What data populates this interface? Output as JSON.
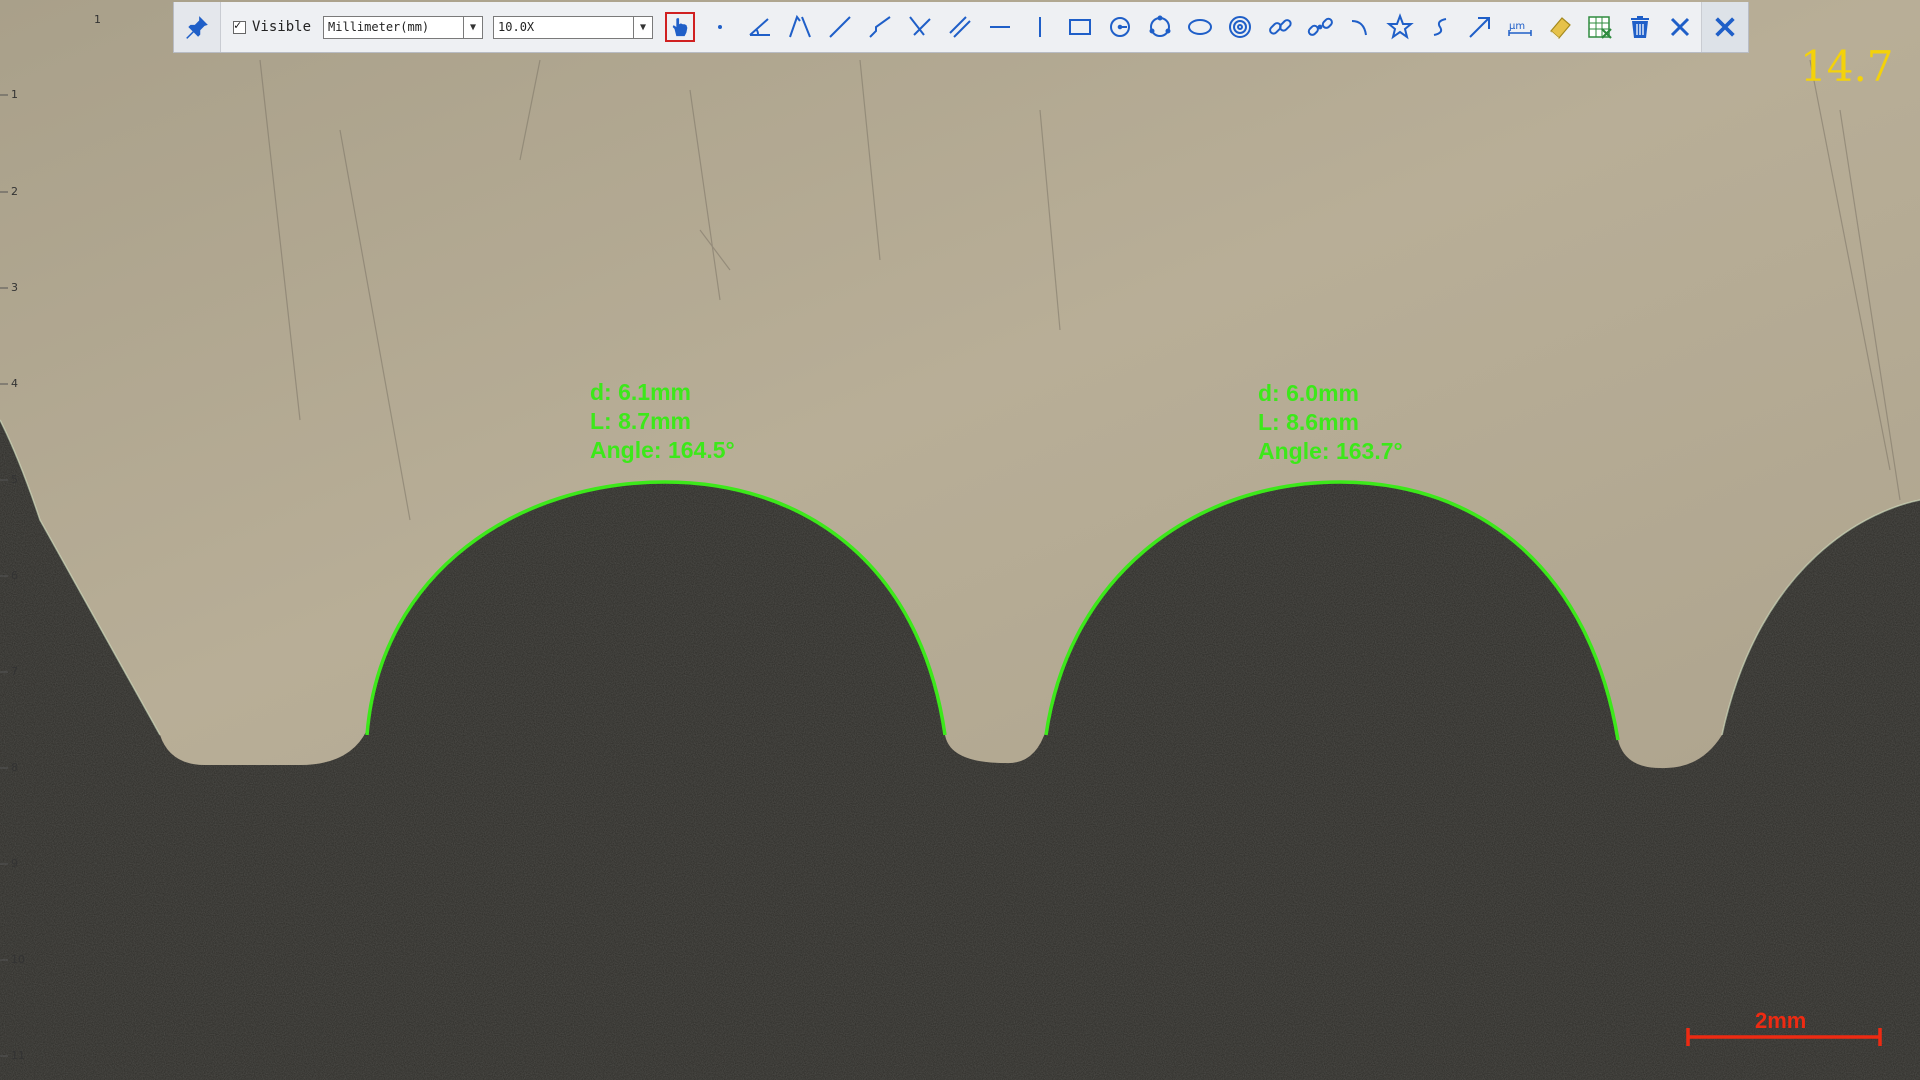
{
  "toolbar": {
    "visible_label": "Visible",
    "unit_select": "Millimeter(mm)",
    "zoom_select": "10.0X",
    "tools": [
      "hand-pointer-icon",
      "point-icon",
      "angle-icon",
      "polyline-angle-icon",
      "line-icon",
      "polyline-icon",
      "cross-lines-icon",
      "parallel-lines-icon",
      "horizontal-line-icon",
      "vertical-line-icon",
      "rectangle-icon",
      "circle-center-icon",
      "circle-three-point-icon",
      "ellipse-icon",
      "concentric-circles-icon",
      "link-icon",
      "link-broken-icon",
      "arc-icon",
      "star-icon",
      "curve-icon",
      "arrow-icon",
      "scale-text-icon",
      "eraser-icon",
      "export-excel-icon",
      "delete-icon",
      "clear-icon"
    ]
  },
  "fps": "14.7",
  "measurements": [
    {
      "diameter": "d: 6.1mm",
      "length": "L: 8.7mm",
      "angle": "Angle: 164.5°"
    },
    {
      "diameter": "d: 6.0mm",
      "length": "L: 8.6mm",
      "angle": "Angle: 163.7°"
    }
  ],
  "scale_bar": {
    "label": "2mm"
  },
  "ruler": {
    "top": [
      "1"
    ],
    "left": [
      "1",
      "2",
      "3",
      "4",
      "5",
      "6",
      "7",
      "8",
      "9",
      "10",
      "11"
    ]
  },
  "colors": {
    "measure": "#3ce81a",
    "scale_bar": "#ee2a12",
    "fps": "#f4d20a",
    "metal": "#b6ab94",
    "background": "#2b2a26"
  }
}
